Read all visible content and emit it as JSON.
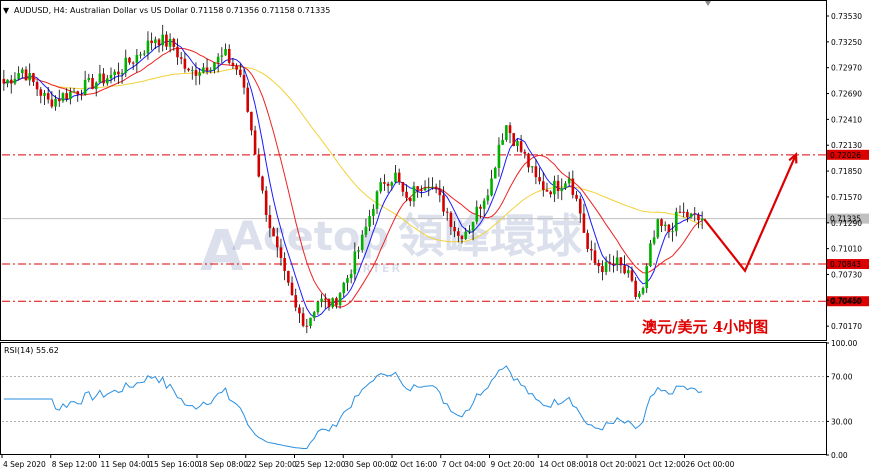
{
  "chart_data": [
    {
      "type": "candlestick",
      "header": "AUDUSD, H4:  Australian Dollar vs US Dollar  0.71158 0.71356 0.71158 0.71335",
      "symbol": "AUDUSD",
      "timeframe": "H4",
      "ylim": [
        0.7002,
        0.7366
      ],
      "y_ticks": [
        "0.73530",
        "0.73250",
        "0.72970",
        "0.72690",
        "0.72410",
        "0.72130",
        "0.71850",
        "0.71570",
        "0.71290",
        "0.71010",
        "0.70730",
        "0.70450",
        "0.70170"
      ],
      "x_ticks": [
        "4 Sep 2020",
        "8 Sep 12:00",
        "11 Sep 04:00",
        "15 Sep 16:00",
        "18 Sep 08:00",
        "22 Sep 20:00",
        "25 Sep 12:00",
        "30 Sep 00:00",
        "2 Oct 16:00",
        "7 Oct 04:00",
        "9 Oct 20:00",
        "14 Oct 08:00",
        "18 Oct 20:00",
        "21 Oct 12:00",
        "26 Oct 00:00"
      ],
      "close_anchors": [
        [
          0,
          0.728
        ],
        [
          5,
          0.7295
        ],
        [
          12,
          0.726
        ],
        [
          18,
          0.727
        ],
        [
          24,
          0.728
        ],
        [
          30,
          0.729
        ],
        [
          36,
          0.731
        ],
        [
          41,
          0.733
        ],
        [
          46,
          0.732
        ],
        [
          50,
          0.729
        ],
        [
          55,
          0.73
        ],
        [
          60,
          0.731
        ],
        [
          64,
          0.729
        ],
        [
          67,
          0.723
        ],
        [
          70,
          0.716
        ],
        [
          73,
          0.711
        ],
        [
          76,
          0.707
        ],
        [
          79,
          0.7035
        ],
        [
          82,
          0.702
        ],
        [
          85,
          0.7045
        ],
        [
          89,
          0.704
        ],
        [
          93,
          0.707
        ],
        [
          97,
          0.711
        ],
        [
          100,
          0.715
        ],
        [
          103,
          0.7175
        ],
        [
          106,
          0.718
        ],
        [
          109,
          0.715
        ],
        [
          112,
          0.717
        ],
        [
          115,
          0.7175
        ],
        [
          117,
          0.716
        ],
        [
          120,
          0.714
        ],
        [
          123,
          0.7115
        ],
        [
          126,
          0.7125
        ],
        [
          129,
          0.715
        ],
        [
          132,
          0.7175
        ],
        [
          134,
          0.7215
        ],
        [
          136,
          0.7235
        ],
        [
          138,
          0.722
        ],
        [
          141,
          0.72
        ],
        [
          144,
          0.7175
        ],
        [
          147,
          0.7165
        ],
        [
          150,
          0.717
        ],
        [
          153,
          0.718
        ],
        [
          156,
          0.714
        ],
        [
          158,
          0.71
        ],
        [
          160,
          0.7085
        ],
        [
          163,
          0.708
        ],
        [
          166,
          0.7085
        ],
        [
          169,
          0.707
        ],
        [
          171,
          0.705
        ],
        [
          173,
          0.7055
        ],
        [
          175,
          0.71
        ],
        [
          177,
          0.7125
        ],
        [
          180,
          0.712
        ],
        [
          183,
          0.714
        ],
        [
          186,
          0.7135
        ],
        [
          189,
          0.713
        ]
      ],
      "indicators": {
        "ma_fast_color": "#1a1aff",
        "ma_mid_color": "#ee2222",
        "ma_slow_color": "#f2d23a"
      },
      "colors": {
        "bull": "#00b000",
        "bear": "#d40000",
        "wick": "#000000"
      },
      "levels": [
        {
          "value": 0.72026,
          "label": "0.72026",
          "style": "dash-dot",
          "color": "#dd0000"
        },
        {
          "value": 0.70843,
          "label": "0.70843",
          "style": "dash-dot",
          "color": "#dd0000"
        },
        {
          "value": 0.7044,
          "label": "0.70440",
          "style": "dash-dot",
          "color": "#dd0000"
        },
        {
          "value": 0.71335,
          "label": "0.71335",
          "style": "solid",
          "color": "#c0c0c0"
        }
      ],
      "projection": {
        "color": "#dd0000",
        "path": [
          [
            0.7133,
            0.7131
          ],
          [
            0.7077,
            0.7079
          ],
          [
            0.7203,
            0.7201
          ]
        ]
      },
      "annotation": "澳元/美元   4小时图",
      "watermark": {
        "brand": "Acetop",
        "cjk": "領峰環球",
        "sub": "ARTER"
      }
    },
    {
      "type": "line",
      "header": "RSI(14) 55.62",
      "ylim": [
        0,
        100
      ],
      "y_ticks": [
        "100.00",
        "70.00",
        "30.00",
        "0.00"
      ],
      "levels": [
        70,
        30
      ],
      "color": "#2a8fe0"
    }
  ]
}
